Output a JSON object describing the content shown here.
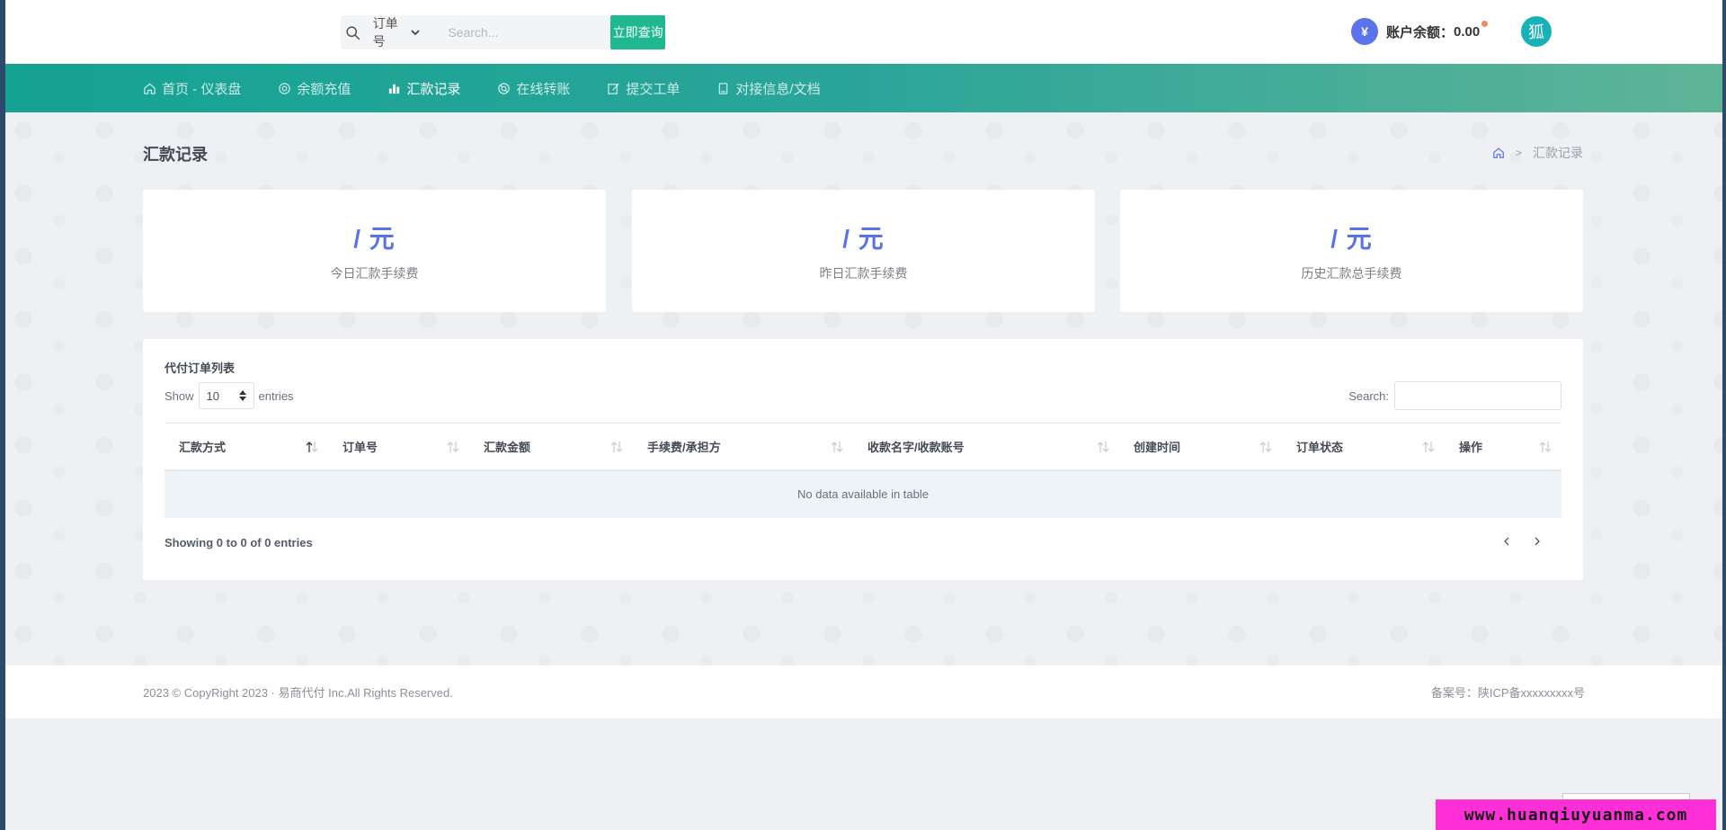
{
  "header": {
    "search": {
      "type_selected": "订单号",
      "placeholder": "Search...",
      "button_label": "立即查询"
    },
    "balance": {
      "icon_glyph": "¥",
      "label": "账户余额：",
      "value": "0.00"
    },
    "avatar_glyph": "狐"
  },
  "nav": {
    "items": [
      {
        "label": "首页 - 仪表盘",
        "icon": "home-icon"
      },
      {
        "label": "余额充值",
        "icon": "coin-icon"
      },
      {
        "label": "汇款记录",
        "icon": "bar-chart-icon",
        "active": true
      },
      {
        "label": "在线转账",
        "icon": "lifebuoy-icon"
      },
      {
        "label": "提交工单",
        "icon": "edit-icon"
      },
      {
        "label": "对接信息/文档",
        "icon": "book-icon"
      }
    ]
  },
  "page": {
    "title": "汇款记录",
    "breadcrumb_current": "汇款记录"
  },
  "stats": [
    {
      "value": "/ 元",
      "label": "今日汇款手续费"
    },
    {
      "value": "/ 元",
      "label": "昨日汇款手续费"
    },
    {
      "value": "/ 元",
      "label": "历史汇款总手续费"
    }
  ],
  "table": {
    "heading": "代付订单列表",
    "show_label": "Show",
    "page_length": "10",
    "entries_label": "entries",
    "search_label": "Search:",
    "columns": [
      "汇款方式",
      "订单号",
      "汇款金额",
      "手续费/承担方",
      "收款名字/收款账号",
      "创建时间",
      "订单状态",
      "操作"
    ],
    "empty_text": "No data available in table",
    "info_text": "Showing 0 to 0 of 0 entries"
  },
  "footer": {
    "copyright": "2023 © CopyRight 2023 · 易商代付 Inc.All Rights Reserved.",
    "icp": "备案号：陕ICP备xxxxxxxxx号"
  },
  "watermark": "www.huanqiuyuanma.com",
  "colors": {
    "accent": "#5b73e8",
    "nav_start": "#15a393",
    "nav_end": "#5fb497",
    "search_button": "#1fb890"
  }
}
